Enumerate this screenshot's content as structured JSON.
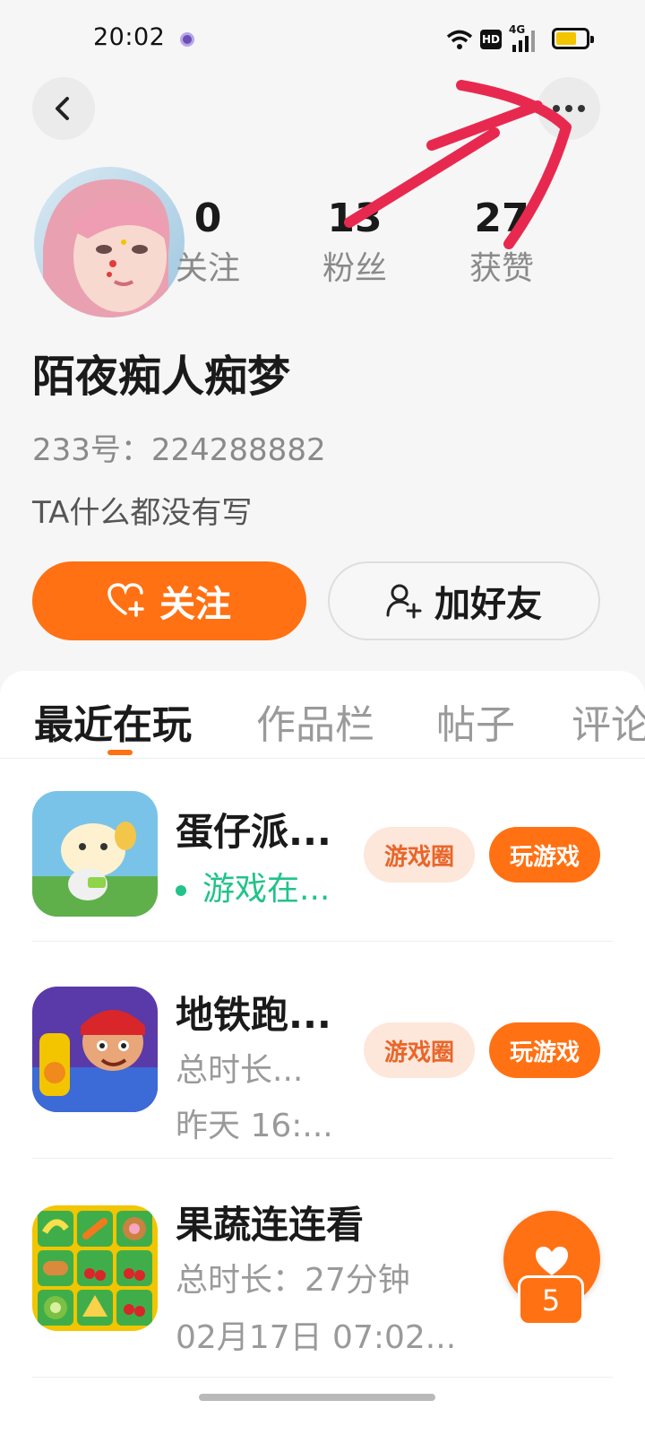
{
  "status_bar": {
    "time": "20:02",
    "hd_badge": "HD",
    "network": "4G",
    "battery_level_percent": 70,
    "battery_color": "#f2c500"
  },
  "nav": {
    "back_icon": "chevron-left-icon",
    "more_icon": "more-dots-icon"
  },
  "profile": {
    "nickname": "陌夜痴人痴梦",
    "user_id": "233号：224288882",
    "bio": "TA什么都没有写",
    "stats": [
      {
        "value": "0",
        "label": "关注"
      },
      {
        "value": "13",
        "label": "粉丝"
      },
      {
        "value": "27",
        "label": "获赞"
      }
    ]
  },
  "actions": {
    "follow_label": "关注",
    "add_friend_label": "加好友",
    "accent_color": "#ff7113"
  },
  "tabs": [
    {
      "label": "最近在玩",
      "active": true
    },
    {
      "label": "作品栏",
      "active": false
    },
    {
      "label": "帖子",
      "active": false
    },
    {
      "label": "评论",
      "active": false
    }
  ],
  "games": [
    {
      "title": "蛋仔派...",
      "subtitle1": "游戏在...",
      "subtitle1_online": true,
      "circle_label": "游戏圈",
      "play_label": "玩游戏"
    },
    {
      "title": "地铁跑...",
      "subtitle1": "总时长...",
      "subtitle2": "昨天 16:...",
      "circle_label": "游戏圈",
      "play_label": "玩游戏"
    },
    {
      "title": "果蔬连连看",
      "subtitle1": "总时长：27分钟",
      "subtitle2": "02月17日 07:02..."
    }
  ],
  "like_badge": {
    "count": "5"
  },
  "annotation_color": "#e8294f"
}
